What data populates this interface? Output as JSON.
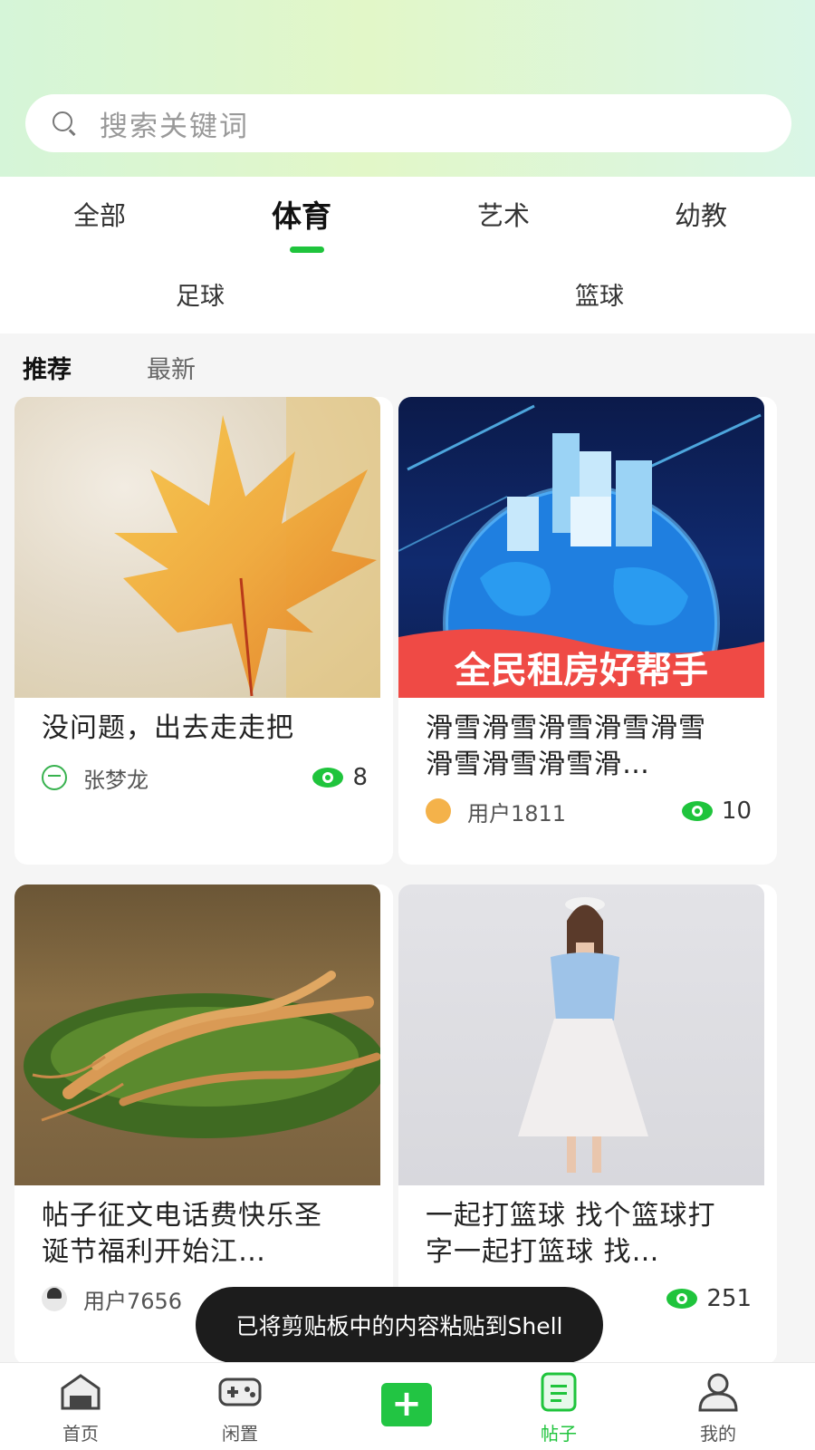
{
  "search": {
    "placeholder": "搜索关键词"
  },
  "tabs": [
    {
      "label": "全部",
      "active": false
    },
    {
      "label": "体育",
      "active": true
    },
    {
      "label": "艺术",
      "active": false
    },
    {
      "label": "幼教",
      "active": false
    }
  ],
  "subtabs": [
    {
      "label": "足球"
    },
    {
      "label": "篮球"
    }
  ],
  "sort": {
    "recommend": "推荐",
    "latest": "最新"
  },
  "posts": [
    {
      "title": "没问题，出去走走把",
      "author": "张梦龙",
      "views": "8",
      "image": "maple-leaf"
    },
    {
      "title": "滑雪滑雪滑雪滑雪滑雪滑雪滑雪滑雪滑…",
      "author": "用户1811",
      "views": "10",
      "image": "city-globe",
      "banner": "全民租房好帮手"
    },
    {
      "title": "帖子征文电话费快乐圣诞节福利开始江…",
      "author": "用户7656",
      "views": "",
      "image": "ginseng"
    },
    {
      "title": "一起打篮球 找个篮球打字一起打篮球 找…",
      "author": "",
      "views": "251",
      "image": "fashion-model"
    }
  ],
  "toast": "已将剪贴板中的内容粘贴到Shell",
  "tabbar": [
    {
      "label": "首页",
      "icon": "home-icon",
      "active": false
    },
    {
      "label": "闲置",
      "icon": "gamepad-icon",
      "active": false
    },
    {
      "label": "",
      "icon": "plus-icon",
      "active": false
    },
    {
      "label": "帖子",
      "icon": "post-icon",
      "active": true
    },
    {
      "label": "我的",
      "icon": "user-icon",
      "active": false
    }
  ],
  "colors": {
    "accent": "#1fc43c",
    "toast_bg": "#1c1c1c"
  }
}
